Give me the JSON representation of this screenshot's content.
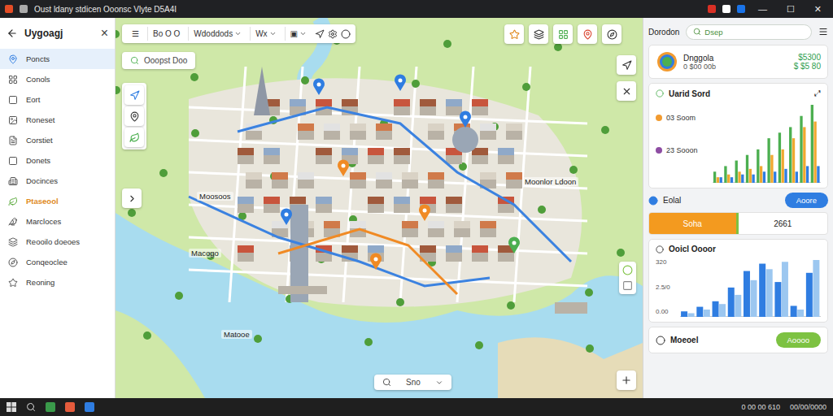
{
  "window": {
    "title": "Oust ldany stdicen Ooonsc Vlyte D5A4I",
    "controls": [
      "—",
      "☐",
      "✕"
    ]
  },
  "sidebar": {
    "title": "Uygoagj",
    "close": "×",
    "items": [
      {
        "label": "Poncts",
        "selected": true,
        "highlighted": false
      },
      {
        "label": "Conols",
        "selected": false,
        "highlighted": false
      },
      {
        "label": "Eort",
        "selected": false,
        "highlighted": false
      },
      {
        "label": "Roneset",
        "selected": false,
        "highlighted": false
      },
      {
        "label": "Corstiet",
        "selected": false,
        "highlighted": false
      },
      {
        "label": "Donets",
        "selected": false,
        "highlighted": false
      },
      {
        "label": "Docinces",
        "selected": false,
        "highlighted": false
      },
      {
        "label": "Ptaseool",
        "selected": false,
        "highlighted": true
      },
      {
        "label": "Marcloces",
        "selected": false,
        "highlighted": false
      },
      {
        "label": "Reooilo doeoes",
        "selected": false,
        "highlighted": false
      },
      {
        "label": "Conqeoclee",
        "selected": false,
        "highlighted": false
      },
      {
        "label": "Reoning",
        "selected": false,
        "highlighted": false
      }
    ]
  },
  "toolbar": {
    "menu": "☰",
    "items": [
      {
        "label": "Bo O O",
        "dropdown": false
      },
      {
        "label": "Wdoddods",
        "dropdown": true
      },
      {
        "label": "Wx",
        "dropdown": true
      },
      {
        "label": "▣",
        "dropdown": true
      }
    ]
  },
  "map": {
    "chip": "Ooopst Doo",
    "labels": [
      "Moosoos",
      "Macogo",
      "Moonlor Ldoon",
      "Matooe"
    ],
    "search": {
      "placeholder": "Sno"
    }
  },
  "right_panel": {
    "header": {
      "title": "Dorodon",
      "search": "Dsep"
    },
    "account": {
      "name": "Dnggola",
      "sub": "0 $00 00b",
      "value": "$5300",
      "change": "$ $5 80"
    },
    "chart1": {
      "title": "Uarid Sord",
      "menu": "⤢",
      "legend": [
        {
          "label": "03 Soom",
          "color": "#f29b30"
        },
        {
          "label": "23 Sooon",
          "color": "#8e4da3"
        }
      ],
      "series": [
        {
          "color": "#4caf50",
          "values": [
            2,
            3,
            4,
            5,
            6,
            8,
            9,
            10,
            12,
            14
          ]
        },
        {
          "color": "#f0a830",
          "values": [
            1,
            1.5,
            2,
            2.5,
            3,
            5,
            6,
            8,
            10,
            11
          ]
        },
        {
          "color": "#2f7de1",
          "values": [
            1,
            1,
            1.5,
            1.5,
            2,
            2,
            2.5,
            2,
            3,
            3
          ]
        }
      ]
    },
    "total": {
      "label": "Eolal",
      "button": "Aoore"
    },
    "progress": {
      "label": "Soha",
      "value": "2661",
      "level": 0.5
    },
    "chart2": {
      "title": "Ooicl Oooor",
      "ticks": [
        "320",
        "2.5/0",
        "0.00"
      ],
      "series": [
        {
          "color": "#2f7de1",
          "values": [
            30,
            55,
            85,
            160,
            250,
            290,
            190,
            60,
            240
          ]
        },
        {
          "color": "#9cc7f0",
          "values": [
            20,
            40,
            70,
            120,
            200,
            260,
            300,
            40,
            310
          ]
        }
      ]
    },
    "footer": {
      "title": "Moeoel",
      "button": "Aoooo"
    }
  },
  "taskbar": {
    "time": "0 00 00 610",
    "date": "00/00/0000"
  }
}
